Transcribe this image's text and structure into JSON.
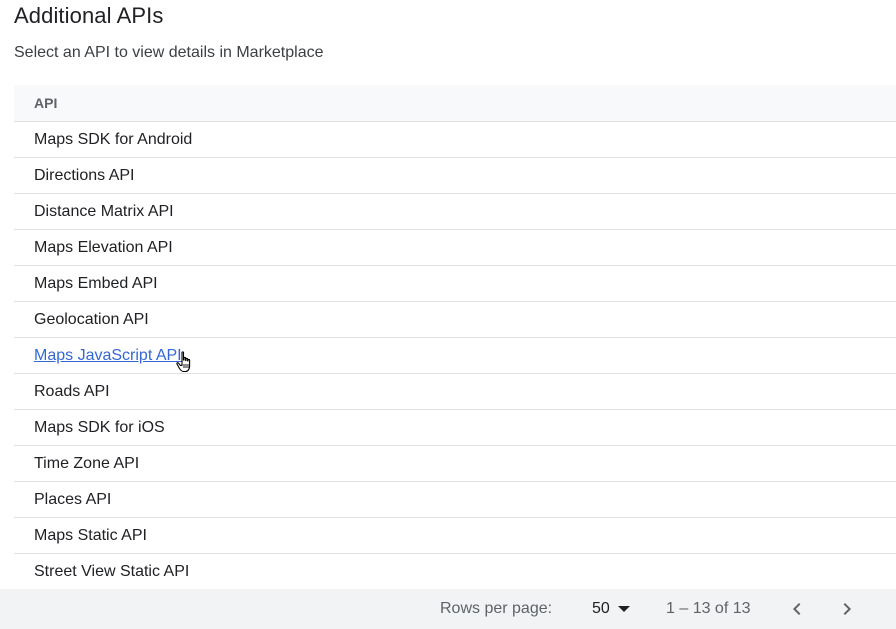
{
  "header": {
    "title": "Additional APIs",
    "subtitle": "Select an API to view details in Marketplace"
  },
  "table": {
    "column_header": "API",
    "rows": [
      "Maps SDK for Android",
      "Directions API",
      "Distance Matrix API",
      "Maps Elevation API",
      "Maps Embed API",
      "Geolocation API",
      "Maps JavaScript API",
      "Roads API",
      "Maps SDK for iOS",
      "Time Zone API",
      "Places API",
      "Maps Static API",
      "Street View Static API"
    ],
    "hovered_row_index": 6
  },
  "pagination": {
    "rows_per_page_label": "Rows per page:",
    "rows_per_page_value": "50",
    "range_label": "1 – 13 of 13"
  },
  "colors": {
    "link_hover": "#3367d6",
    "header_bg": "#f8f9fa",
    "footer_bg": "#f1f3f4",
    "divider": "#e0e0e0"
  },
  "icons": {
    "dropdown": "caret-down-icon",
    "previous": "chevron-left-icon",
    "next": "chevron-right-icon",
    "cursor": "hand-pointer-cursor-icon"
  }
}
